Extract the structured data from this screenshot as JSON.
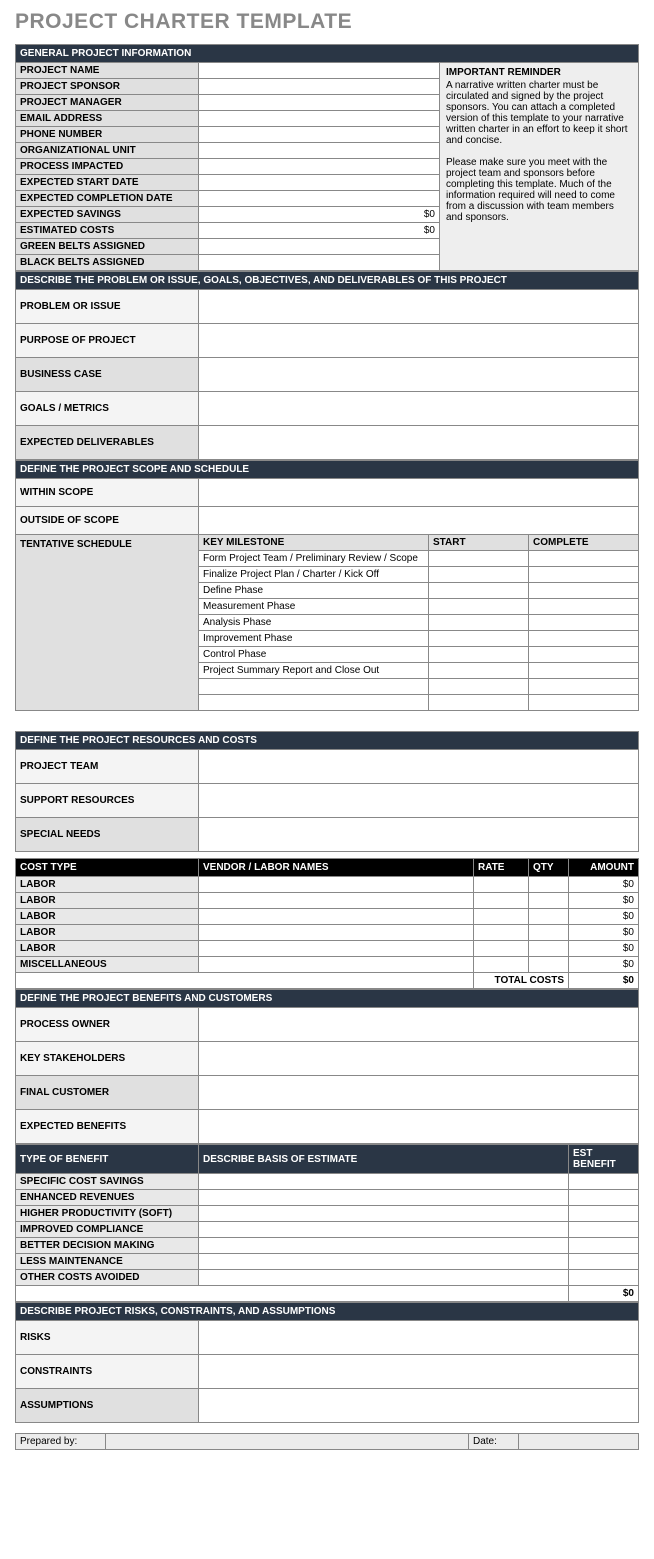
{
  "title": "PROJECT CHARTER TEMPLATE",
  "general": {
    "header": "GENERAL PROJECT INFORMATION",
    "rows": [
      {
        "label": "PROJECT NAME",
        "value": ""
      },
      {
        "label": "PROJECT SPONSOR",
        "value": ""
      },
      {
        "label": "PROJECT MANAGER",
        "value": ""
      },
      {
        "label": "EMAIL ADDRESS",
        "value": ""
      },
      {
        "label": "PHONE NUMBER",
        "value": ""
      },
      {
        "label": "ORGANIZATIONAL UNIT",
        "value": ""
      },
      {
        "label": "PROCESS IMPACTED",
        "value": ""
      },
      {
        "label": "EXPECTED START DATE",
        "value": ""
      },
      {
        "label": "EXPECTED COMPLETION DATE",
        "value": ""
      },
      {
        "label": "EXPECTED SAVINGS",
        "value": "$0"
      },
      {
        "label": "ESTIMATED COSTS",
        "value": "$0"
      },
      {
        "label": "GREEN BELTS ASSIGNED",
        "value": ""
      },
      {
        "label": "BLACK BELTS ASSIGNED",
        "value": ""
      }
    ],
    "reminder": {
      "title": "IMPORTANT REMINDER",
      "p1": "A narrative written charter must be circulated and signed by the project sponsors. You can attach a completed version of this template to your narrative written charter in an effort to keep it short and concise.",
      "p2": "Please make sure you meet with the project team and sponsors before completing this template. Much of the information required will need to come from a discussion with team members and sponsors."
    }
  },
  "problem": {
    "header": "DESCRIBE THE PROBLEM OR ISSUE, GOALS, OBJECTIVES, AND DELIVERABLES OF THIS PROJECT",
    "rows": [
      {
        "label": "PROBLEM OR ISSUE",
        "value": ""
      },
      {
        "label": "PURPOSE OF PROJECT",
        "value": ""
      },
      {
        "label": "BUSINESS CASE",
        "value": ""
      },
      {
        "label": "GOALS / METRICS",
        "value": ""
      },
      {
        "label": "EXPECTED DELIVERABLES",
        "value": ""
      }
    ]
  },
  "scope": {
    "header": "DEFINE THE PROJECT SCOPE AND SCHEDULE",
    "rows": [
      {
        "label": "WITHIN SCOPE",
        "value": ""
      },
      {
        "label": "OUTSIDE OF  SCOPE",
        "value": ""
      }
    ],
    "schedule_label": "TENTATIVE SCHEDULE",
    "schedule_headers": {
      "milestone": "KEY MILESTONE",
      "start": "START",
      "complete": "COMPLETE"
    },
    "milestones": [
      {
        "name": "Form Project Team / Preliminary Review / Scope",
        "start": "",
        "complete": ""
      },
      {
        "name": "Finalize Project Plan / Charter / Kick Off",
        "start": "",
        "complete": ""
      },
      {
        "name": "Define Phase",
        "start": "",
        "complete": ""
      },
      {
        "name": "Measurement Phase",
        "start": "",
        "complete": ""
      },
      {
        "name": "Analysis Phase",
        "start": "",
        "complete": ""
      },
      {
        "name": "Improvement Phase",
        "start": "",
        "complete": ""
      },
      {
        "name": "Control Phase",
        "start": "",
        "complete": ""
      },
      {
        "name": "Project Summary Report and Close Out",
        "start": "",
        "complete": ""
      },
      {
        "name": "",
        "start": "",
        "complete": ""
      },
      {
        "name": "",
        "start": "",
        "complete": ""
      }
    ]
  },
  "resources": {
    "header": "DEFINE THE PROJECT RESOURCES AND COSTS",
    "rows": [
      {
        "label": "PROJECT TEAM",
        "value": ""
      },
      {
        "label": "SUPPORT RESOURCES",
        "value": ""
      },
      {
        "label": "SPECIAL NEEDS",
        "value": ""
      }
    ]
  },
  "costs": {
    "headers": {
      "type": "COST TYPE",
      "vendor": "VENDOR / LABOR NAMES",
      "rate": "RATE",
      "qty": "QTY",
      "amount": "AMOUNT"
    },
    "rows": [
      {
        "type": "LABOR",
        "vendor": "",
        "rate": "",
        "qty": "",
        "amount": "$0"
      },
      {
        "type": "LABOR",
        "vendor": "",
        "rate": "",
        "qty": "",
        "amount": "$0"
      },
      {
        "type": "LABOR",
        "vendor": "",
        "rate": "",
        "qty": "",
        "amount": "$0"
      },
      {
        "type": "LABOR",
        "vendor": "",
        "rate": "",
        "qty": "",
        "amount": "$0"
      },
      {
        "type": "LABOR",
        "vendor": "",
        "rate": "",
        "qty": "",
        "amount": "$0"
      },
      {
        "type": "MISCELLANEOUS",
        "vendor": "",
        "rate": "",
        "qty": "",
        "amount": "$0"
      }
    ],
    "total_label": "TOTAL COSTS",
    "total_value": "$0"
  },
  "benefits": {
    "header": "DEFINE THE PROJECT BENEFITS AND CUSTOMERS",
    "rows": [
      {
        "label": "PROCESS OWNER",
        "value": ""
      },
      {
        "label": "KEY STAKEHOLDERS",
        "value": ""
      },
      {
        "label": "FINAL CUSTOMER",
        "value": ""
      },
      {
        "label": "EXPECTED BENEFITS",
        "value": ""
      }
    ]
  },
  "benefit_types": {
    "headers": {
      "type": "TYPE OF BENEFIT",
      "basis": "DESCRIBE BASIS OF ESTIMATE",
      "est": "EST BENEFIT"
    },
    "rows": [
      {
        "type": "SPECIFIC COST SAVINGS",
        "basis": "",
        "est": ""
      },
      {
        "type": "ENHANCED REVENUES",
        "basis": "",
        "est": ""
      },
      {
        "type": "HIGHER PRODUCTIVITY (SOFT)",
        "basis": "",
        "est": ""
      },
      {
        "type": "IMPROVED COMPLIANCE",
        "basis": "",
        "est": ""
      },
      {
        "type": "BETTER DECISION MAKING",
        "basis": "",
        "est": ""
      },
      {
        "type": "LESS MAINTENANCE",
        "basis": "",
        "est": ""
      },
      {
        "type": "OTHER COSTS AVOIDED",
        "basis": "",
        "est": ""
      }
    ],
    "total_value": "$0"
  },
  "risks": {
    "header": "DESCRIBE PROJECT RISKS, CONSTRAINTS, AND ASSUMPTIONS",
    "rows": [
      {
        "label": "RISKS",
        "value": ""
      },
      {
        "label": "CONSTRAINTS",
        "value": ""
      },
      {
        "label": "ASSUMPTIONS",
        "value": ""
      }
    ]
  },
  "footer": {
    "prepared": "Prepared by:",
    "date": "Date:"
  }
}
